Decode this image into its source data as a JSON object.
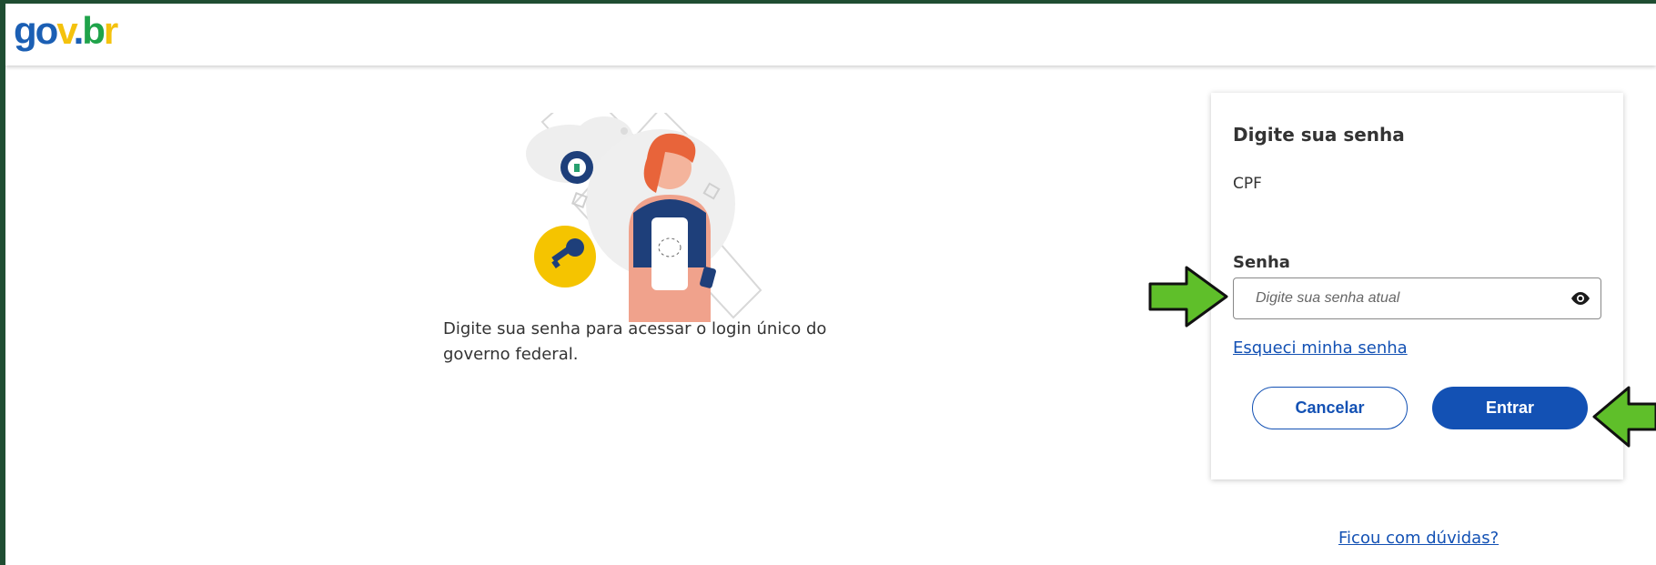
{
  "header": {
    "logo": {
      "part1": "go",
      "part2": "v",
      "dot": ".",
      "part3": "b",
      "part4": "r"
    }
  },
  "intro": {
    "text": "Digite sua senha para acessar o login único do governo federal."
  },
  "card": {
    "title": "Digite sua senha",
    "cpf_label": "CPF",
    "password_label": "Senha",
    "password_placeholder": "Digite sua senha atual",
    "password_value": "",
    "forgot_link": "Esqueci minha senha",
    "cancel_label": "Cancelar",
    "enter_label": "Entrar"
  },
  "footer": {
    "help_link": "Ficou com dúvidas?"
  },
  "icons": {
    "show_password": "eye-icon",
    "illustration_key": "key-icon",
    "illustration_lock": "lock-icon",
    "annotation": "arrow-icon"
  },
  "colors": {
    "primary": "#1351b4",
    "annotation_arrow": "#5fbf2a",
    "frame_background": "#1f4d32"
  }
}
